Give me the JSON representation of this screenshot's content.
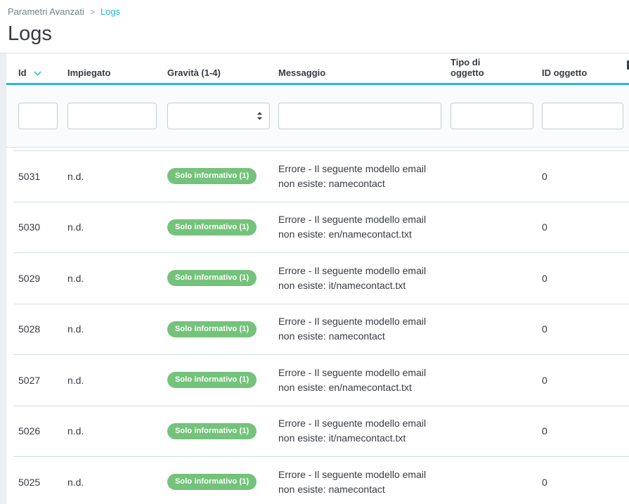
{
  "breadcrumb": {
    "parent": "Parametri Avanzati",
    "separator": ">",
    "current": "Logs"
  },
  "page": {
    "title": "Logs"
  },
  "icons": {
    "sort": "chevron-down-icon",
    "select_caret": "up-down-arrows-icon"
  },
  "colors": {
    "accent": "#25b9d7",
    "badge_success": "#74c27b",
    "text": "#363a41",
    "muted": "#6c868e"
  },
  "table": {
    "columns": [
      {
        "key": "id",
        "label": "Id",
        "sortable": true
      },
      {
        "key": "impiegato",
        "label": "Impiegato"
      },
      {
        "key": "gravita",
        "label": "Gravità (1-4)"
      },
      {
        "key": "messaggio",
        "label": "Messaggio"
      },
      {
        "key": "tipo_oggetto",
        "label": "Tipo di oggetto"
      },
      {
        "key": "id_oggetto",
        "label": "ID oggetto"
      }
    ],
    "filters": {
      "id": "",
      "impiegato": "",
      "gravita_selected": "",
      "messaggio": "",
      "tipo_oggetto": "",
      "id_oggetto": ""
    },
    "rows": [
      {
        "id": "5031",
        "impiegato": "n.d.",
        "gravita": "Solo informativo (1)",
        "message_lines": [
          "Errore - Il seguente modello email",
          "non esiste: namecontact"
        ],
        "tipo_oggetto": "",
        "id_oggetto": "0"
      },
      {
        "id": "5030",
        "impiegato": "n.d.",
        "gravita": "Solo informativo (1)",
        "message_lines": [
          "Errore - Il seguente modello email",
          "non esiste: en/namecontact.txt"
        ],
        "tipo_oggetto": "",
        "id_oggetto": "0"
      },
      {
        "id": "5029",
        "impiegato": "n.d.",
        "gravita": "Solo informativo (1)",
        "message_lines": [
          "Errore - Il seguente modello email",
          "non esiste: it/namecontact.txt"
        ],
        "tipo_oggetto": "",
        "id_oggetto": "0"
      },
      {
        "id": "5028",
        "impiegato": "n.d.",
        "gravita": "Solo informativo (1)",
        "message_lines": [
          "Errore - Il seguente modello email",
          "non esiste: namecontact"
        ],
        "tipo_oggetto": "",
        "id_oggetto": "0"
      },
      {
        "id": "5027",
        "impiegato": "n.d.",
        "gravita": "Solo informativo (1)",
        "message_lines": [
          "Errore - Il seguente modello email",
          "non esiste: en/namecontact.txt"
        ],
        "tipo_oggetto": "",
        "id_oggetto": "0"
      },
      {
        "id": "5026",
        "impiegato": "n.d.",
        "gravita": "Solo informativo (1)",
        "message_lines": [
          "Errore - Il seguente modello email",
          "non esiste: it/namecontact.txt"
        ],
        "tipo_oggetto": "",
        "id_oggetto": "0"
      },
      {
        "id": "5025",
        "impiegato": "n.d.",
        "gravita": "Solo informativo (1)",
        "message_lines": [
          "Errore - Il seguente modello email",
          "non esiste: namecontact"
        ],
        "tipo_oggetto": "",
        "id_oggetto": "0"
      }
    ]
  }
}
